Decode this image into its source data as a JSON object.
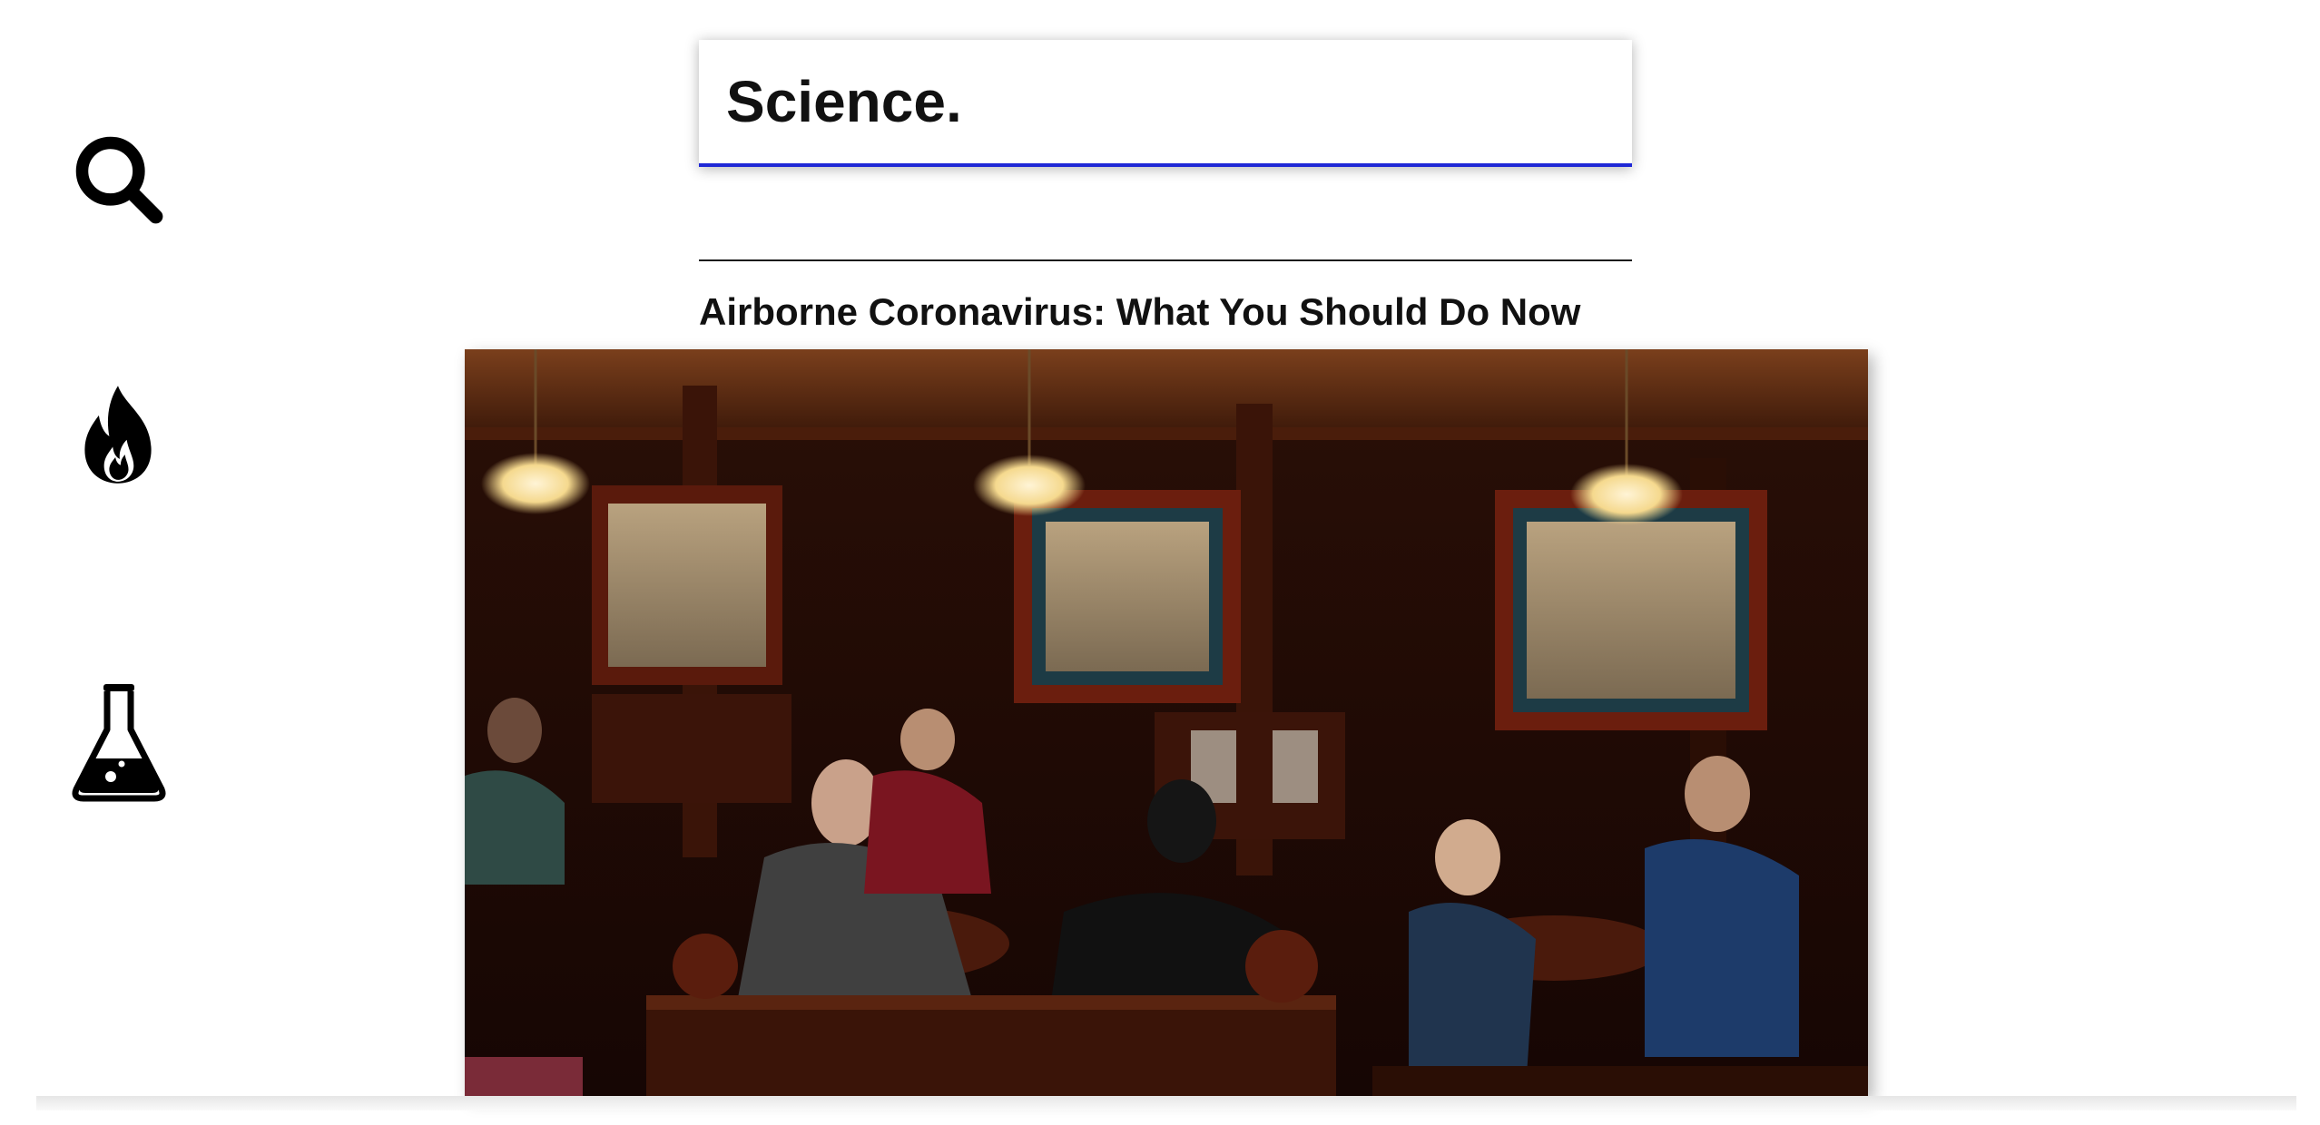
{
  "search": {
    "value": "Science."
  },
  "sidebar": {
    "items": [
      {
        "icon": "search-icon"
      },
      {
        "icon": "fire-icon"
      },
      {
        "icon": "flask-icon"
      }
    ]
  },
  "article": {
    "title": "Airborne Coronavirus: What You Should Do Now"
  },
  "colors": {
    "accent": "#1f28d6",
    "text": "#111111"
  }
}
